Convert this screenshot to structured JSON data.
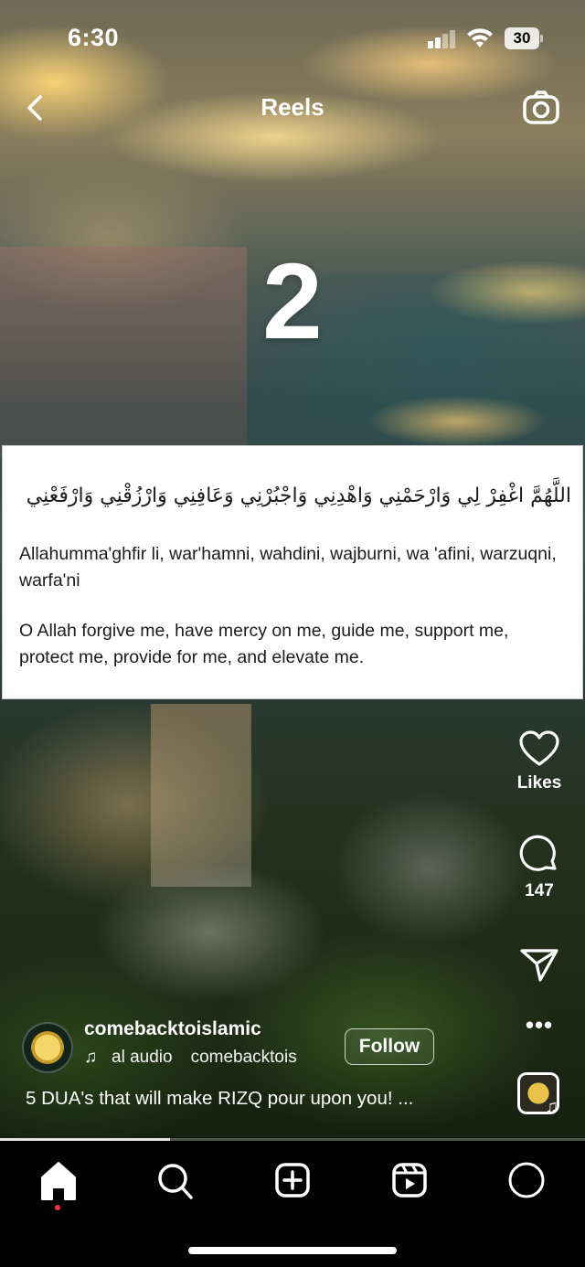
{
  "status_bar": {
    "time": "6:30",
    "battery": "30"
  },
  "header": {
    "title": "Reels"
  },
  "reel": {
    "overlay_number": "2",
    "card": {
      "arabic": "اللَّهُمَّ اغْفِرْ لِي وَارْحَمْنِي وَاهْدِنِي وَاجْبُرْنِي وَعَافِنِي وَارْزُقْنِي وَارْفَعْنِي",
      "transliteration": "Allahumma'ghfir li, war'hamni, wahdini, wajburni, wa 'afini, warzuqni, warfa'ni",
      "meaning": "O Allah forgive me, have mercy on me, guide me, support me, protect me, provide for me, and elevate me."
    },
    "progress_fraction": 0.29
  },
  "actions": {
    "likes_label": "Likes",
    "comments_count": "147",
    "more_label": "•••"
  },
  "account": {
    "username": "comebacktoislamic",
    "audio_label": "al audio",
    "audio_source": "comebacktois",
    "follow_label": "Follow",
    "caption": "5 DUA's that will make RIZQ pour upon you! ..."
  },
  "icons": {
    "back": "chevron-left-icon",
    "camera": "camera-icon",
    "like": "heart-icon",
    "comment": "comment-bubble-icon",
    "share": "paper-plane-icon",
    "home": "home-icon",
    "search": "search-icon",
    "create": "plus-square-icon",
    "reels": "reels-icon",
    "profile": "profile-icon"
  },
  "colors": {
    "notification_dot": "#ff3040",
    "card_background": "#ffffff"
  }
}
